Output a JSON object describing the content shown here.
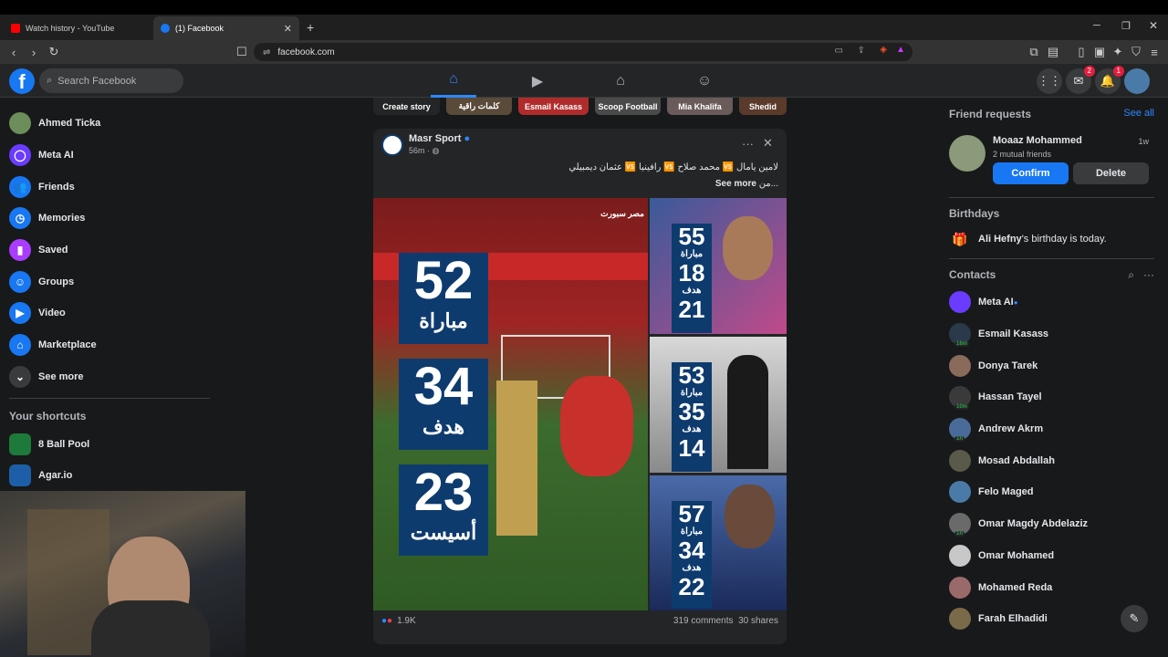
{
  "browser": {
    "tabs": [
      {
        "label": "Watch history - YouTube"
      },
      {
        "label": "(1) Facebook"
      }
    ],
    "new_tab": "+",
    "url": "facebook.com"
  },
  "header": {
    "logo": "f",
    "search_placeholder": "Search Facebook",
    "messenger_badge": "2",
    "notifications_badge": "1"
  },
  "leftnav": {
    "items": [
      {
        "label": "Ahmed Ticka",
        "icon": "avatar",
        "color": "#6b8e5a"
      },
      {
        "label": "Meta AI",
        "icon": "meta-ai-icon",
        "color": "#6a3cff"
      },
      {
        "label": "Friends",
        "icon": "friends-icon",
        "color": "#1877f2"
      },
      {
        "label": "Memories",
        "icon": "clock-icon",
        "color": "#1877f2"
      },
      {
        "label": "Saved",
        "icon": "bookmark-icon",
        "color": "#a93cff"
      },
      {
        "label": "Groups",
        "icon": "groups-icon",
        "color": "#1877f2"
      },
      {
        "label": "Video",
        "icon": "video-icon",
        "color": "#1877f2"
      },
      {
        "label": "Marketplace",
        "icon": "marketplace-icon",
        "color": "#1877f2"
      },
      {
        "label": "See more",
        "icon": "chevron-down-icon",
        "color": "#3a3b3c"
      }
    ],
    "shortcuts_title": "Your shortcuts",
    "shortcuts": [
      {
        "label": "8 Ball Pool",
        "color": "#1e7a3a"
      },
      {
        "label": "Agar.io",
        "color": "#1c5fa8"
      }
    ]
  },
  "stories": [
    {
      "label": "Create story"
    },
    {
      "label": "كلمات راقية"
    },
    {
      "label": "Esmail Kasass"
    },
    {
      "label": "Scoop Football"
    },
    {
      "label": "Mia Khalifa"
    },
    {
      "label": "Shedid"
    }
  ],
  "post": {
    "author": "Masr Sport",
    "time": "56m · ",
    "text": "لامين يامال 🆚 محمد صلاح 🆚 رافينيا 🆚 عثمان ديمبيلي",
    "text_more": "من...",
    "see_more": "See more",
    "main_stats": [
      {
        "num": "52",
        "label": "مباراة"
      },
      {
        "num": "34",
        "label": "هدف"
      },
      {
        "num": "23",
        "label": "أسيست"
      }
    ],
    "side_panels": [
      {
        "stats": [
          {
            "num": "55",
            "label": "مباراة"
          },
          {
            "num": "18",
            "label": "هدف"
          },
          {
            "num": "21",
            "label": ""
          }
        ]
      },
      {
        "stats": [
          {
            "num": "53",
            "label": "مباراة"
          },
          {
            "num": "35",
            "label": "هدف"
          },
          {
            "num": "14",
            "label": ""
          }
        ]
      },
      {
        "stats": [
          {
            "num": "57",
            "label": "مباراة"
          },
          {
            "num": "34",
            "label": "هدف"
          },
          {
            "num": "22",
            "label": ""
          }
        ]
      }
    ],
    "logo_text": "مصر سبورت",
    "reactions": "1.9K",
    "comments": "319 comments",
    "shares": "30 shares"
  },
  "right": {
    "friend_requests_title": "Friend requests",
    "see_all": "See all",
    "request": {
      "name": "Moaaz Mohammed",
      "time": "1w",
      "mutual": "2 mutual friends",
      "confirm": "Confirm",
      "delete": "Delete"
    },
    "birthdays_title": "Birthdays",
    "birthday_name": "Ali Hefny",
    "birthday_text": "'s birthday is today.",
    "contacts_title": "Contacts",
    "contacts": [
      {
        "name": "Meta AI",
        "color": "#6a3cff",
        "status": "",
        "verified": true
      },
      {
        "name": "Esmail Kasass",
        "color": "#2b3a4a",
        "status": "18m"
      },
      {
        "name": "Donya Tarek",
        "color": "#8a6a5a",
        "status": ""
      },
      {
        "name": "Hassan Tayel",
        "color": "#3a3a3a",
        "status": "10m"
      },
      {
        "name": "Andrew Akrm",
        "color": "#4a6a9a",
        "status": "1h"
      },
      {
        "name": "Mosad Abdallah",
        "color": "#5a5a4a",
        "status": ""
      },
      {
        "name": "Felo Maged",
        "color": "#4a7aa8",
        "status": ""
      },
      {
        "name": "Omar Magdy Abdelaziz",
        "color": "#6a6a6a",
        "status": "1h"
      },
      {
        "name": "Omar Mohamed",
        "color": "#c8c8c8",
        "status": ""
      },
      {
        "name": "Mohamed Reda",
        "color": "#9a6a6a",
        "status": ""
      },
      {
        "name": "Farah Elhadidi",
        "color": "#7a6a4a",
        "status": ""
      }
    ]
  }
}
